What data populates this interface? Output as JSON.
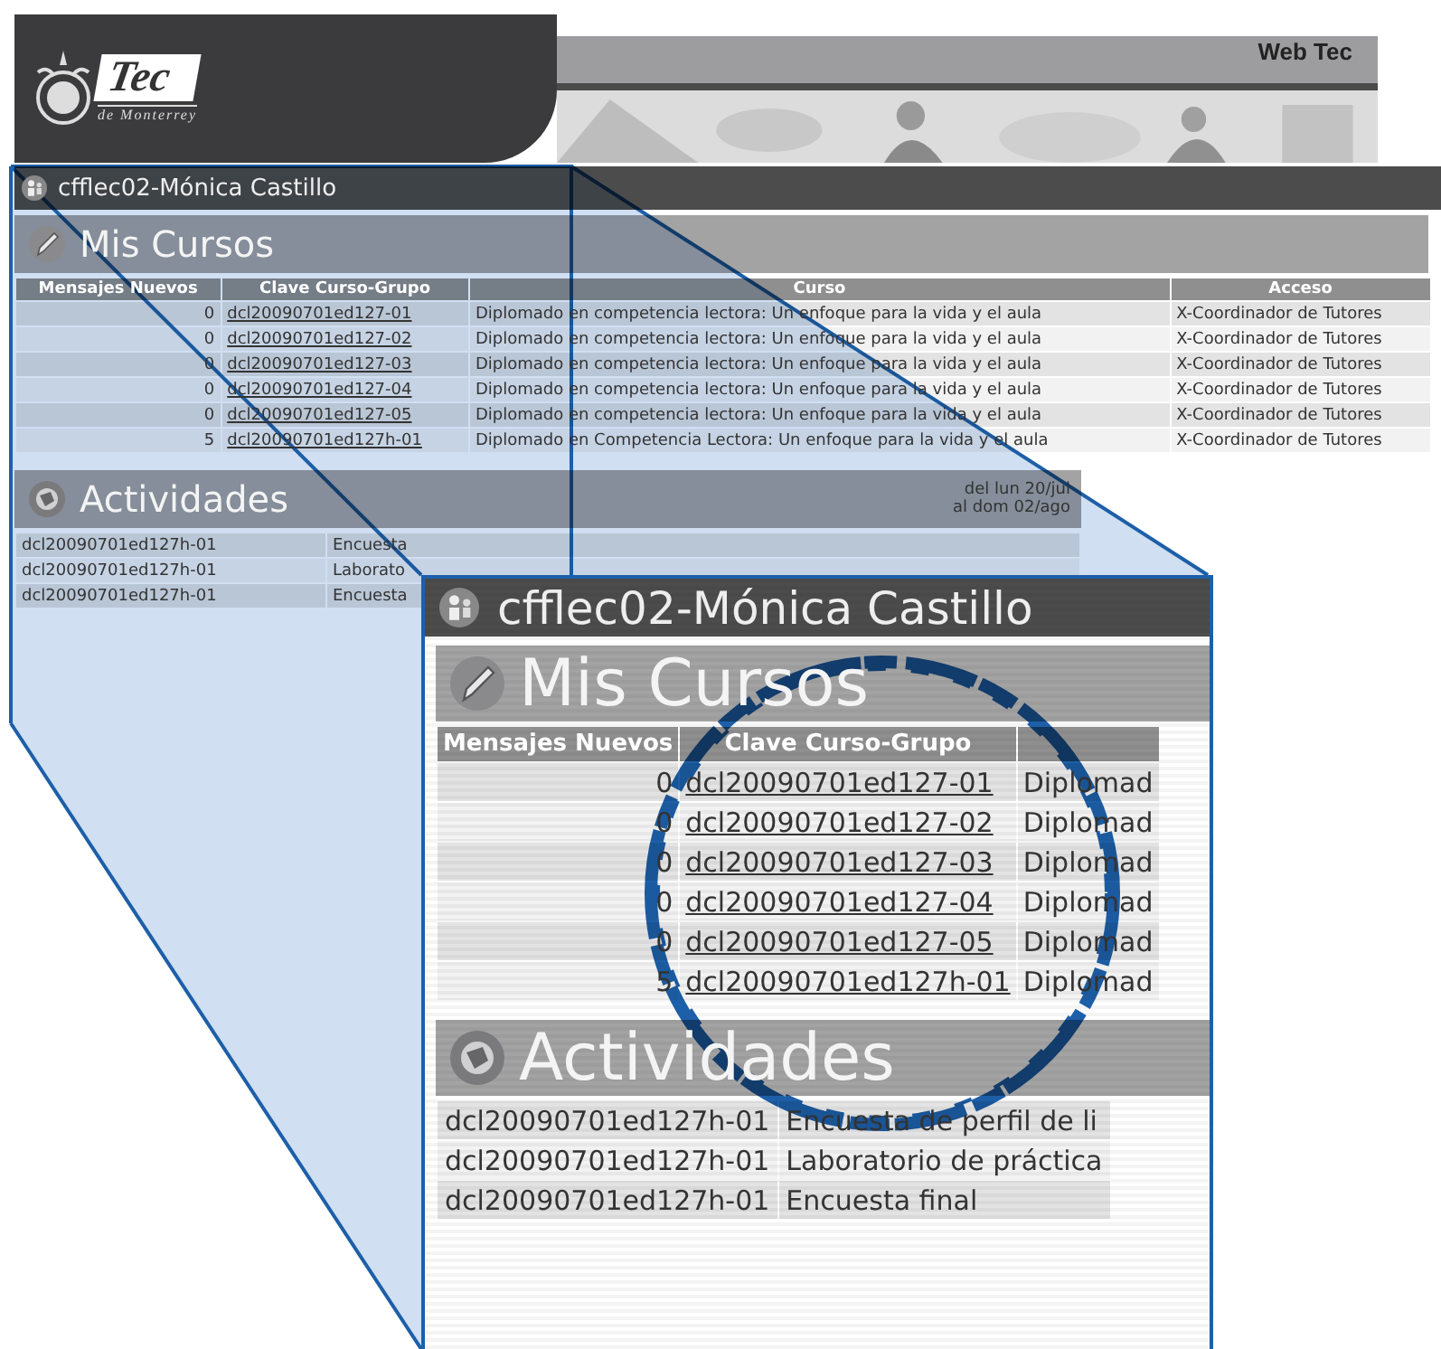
{
  "header": {
    "logo": {
      "name": "Tec",
      "subtitle": "de Monterrey"
    },
    "site_title": "Web Tec"
  },
  "user_bar": {
    "name": "cfflec02-Mónica Castillo"
  },
  "courses": {
    "title": "Mis Cursos",
    "columns": [
      "Mensajes Nuevos",
      "Clave Curso-Grupo",
      "Curso",
      "Acceso"
    ],
    "rows": [
      {
        "new_messages": "0",
        "code": "dcl20090701ed127-01",
        "course": "Diplomado en competencia lectora: Un enfoque para la vida y el aula",
        "access": "X-Coordinador de Tutores"
      },
      {
        "new_messages": "0",
        "code": "dcl20090701ed127-02",
        "course": "Diplomado en competencia lectora: Un enfoque para la vida y el aula",
        "access": "X-Coordinador de Tutores"
      },
      {
        "new_messages": "0",
        "code": "dcl20090701ed127-03",
        "course": "Diplomado en competencia lectora: Un enfoque para la vida y el aula",
        "access": "X-Coordinador de Tutores"
      },
      {
        "new_messages": "0",
        "code": "dcl20090701ed127-04",
        "course": "Diplomado en competencia lectora: Un enfoque para la vida y el aula",
        "access": "X-Coordinador de Tutores"
      },
      {
        "new_messages": "0",
        "code": "dcl20090701ed127-05",
        "course": "Diplomado en competencia lectora: Un enfoque para la vida y el aula",
        "access": "X-Coordinador de Tutores"
      },
      {
        "new_messages": "5",
        "code": "dcl20090701ed127h-01",
        "course": "Diplomado en Competencia Lectora: Un enfoque para la vida y el aula",
        "access": "X-Coordinador de Tutores"
      }
    ]
  },
  "activities": {
    "title": "Actividades",
    "date_range": [
      "del lun 20/jul",
      "al dom 02/ago"
    ],
    "rows": [
      {
        "code": "dcl20090701ed127h-01",
        "activity": "Encuesta"
      },
      {
        "code": "dcl20090701ed127h-01",
        "activity": "Laborato"
      },
      {
        "code": "dcl20090701ed127h-01",
        "activity": "Encuesta"
      }
    ]
  },
  "zoom_inset": {
    "user_bar": {
      "name": "cfflec02-Mónica Castillo"
    },
    "courses": {
      "title": "Mis Cursos",
      "columns": [
        "Mensajes Nuevos",
        "Clave Curso-Grupo"
      ],
      "rows": [
        {
          "new_messages": "0",
          "code": "dcl20090701ed127-01",
          "course": "Diplomad"
        },
        {
          "new_messages": "0",
          "code": "dcl20090701ed127-02",
          "course": "Diplomad"
        },
        {
          "new_messages": "0",
          "code": "dcl20090701ed127-03",
          "course": "Diplomad"
        },
        {
          "new_messages": "0",
          "code": "dcl20090701ed127-04",
          "course": "Diplomad"
        },
        {
          "new_messages": "0",
          "code": "dcl20090701ed127-05",
          "course": "Diplomad"
        },
        {
          "new_messages": "5",
          "code": "dcl20090701ed127h-01",
          "course": "Diplomad"
        }
      ]
    },
    "activities": {
      "title": "Actividades",
      "rows": [
        {
          "code": "dcl20090701ed127h-01",
          "activity": "Encuesta de perfil de li"
        },
        {
          "code": "dcl20090701ed127h-01",
          "activity": "Laboratorio de práctica"
        },
        {
          "code": "dcl20090701ed127h-01",
          "activity": "Encuesta final"
        }
      ]
    }
  }
}
